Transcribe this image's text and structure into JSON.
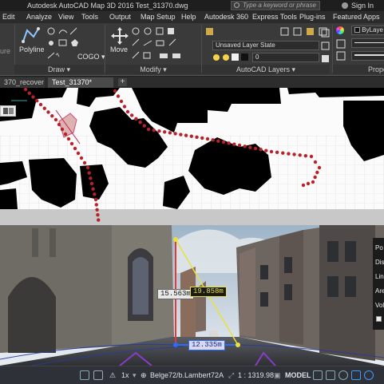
{
  "title_bar": {
    "app_title": "Autodesk AutoCAD Map 3D 2016   Test_31370.dwg",
    "search_placeholder": "Type a keyword or phrase",
    "signin_label": "Sign In"
  },
  "menu": [
    "Edit",
    "Analyze",
    "View",
    "Tools",
    "Output",
    "Map Setup",
    "Help",
    "Autodesk 360",
    "Express Tools",
    "Plug-ins",
    "Featured Apps"
  ],
  "ribbon": {
    "draw_panel_label": "Draw ▾",
    "modify_panel_label": "Modify ▾",
    "layers_panel_label": "AutoCAD Layers ▾",
    "properties_panel_label": "Prope",
    "polyline_label": "Polyline",
    "cogo_label": "COGO ▾",
    "move_label": "Move",
    "layer_state_value": "Unsaved Layer State",
    "layer_value": "0",
    "bylayer_value": "ByLaye",
    "left_cut_label": "ure"
  },
  "doc_tabs": [
    {
      "label": "370_recover",
      "active": false
    },
    {
      "label": "Test_31370*",
      "active": true
    }
  ],
  "measurements": {
    "vertical": "15.563m",
    "diagonal": "19.858m",
    "horizontal": "12.335m"
  },
  "properties_panel": [
    "Po",
    "Dis",
    "Lin",
    "Are",
    "Vol"
  ],
  "status_bar": {
    "scale_factor": "1x",
    "coordinate_system": "Belge72/b.Lambert72A",
    "scale": "1 : 1319.98",
    "space": "MODEL"
  },
  "colors": {
    "route_dots": "#b8222a",
    "vertical_line": "#e53935",
    "diagonal_line": "#e8e23a",
    "horizontal_line": "#2b6cff"
  }
}
